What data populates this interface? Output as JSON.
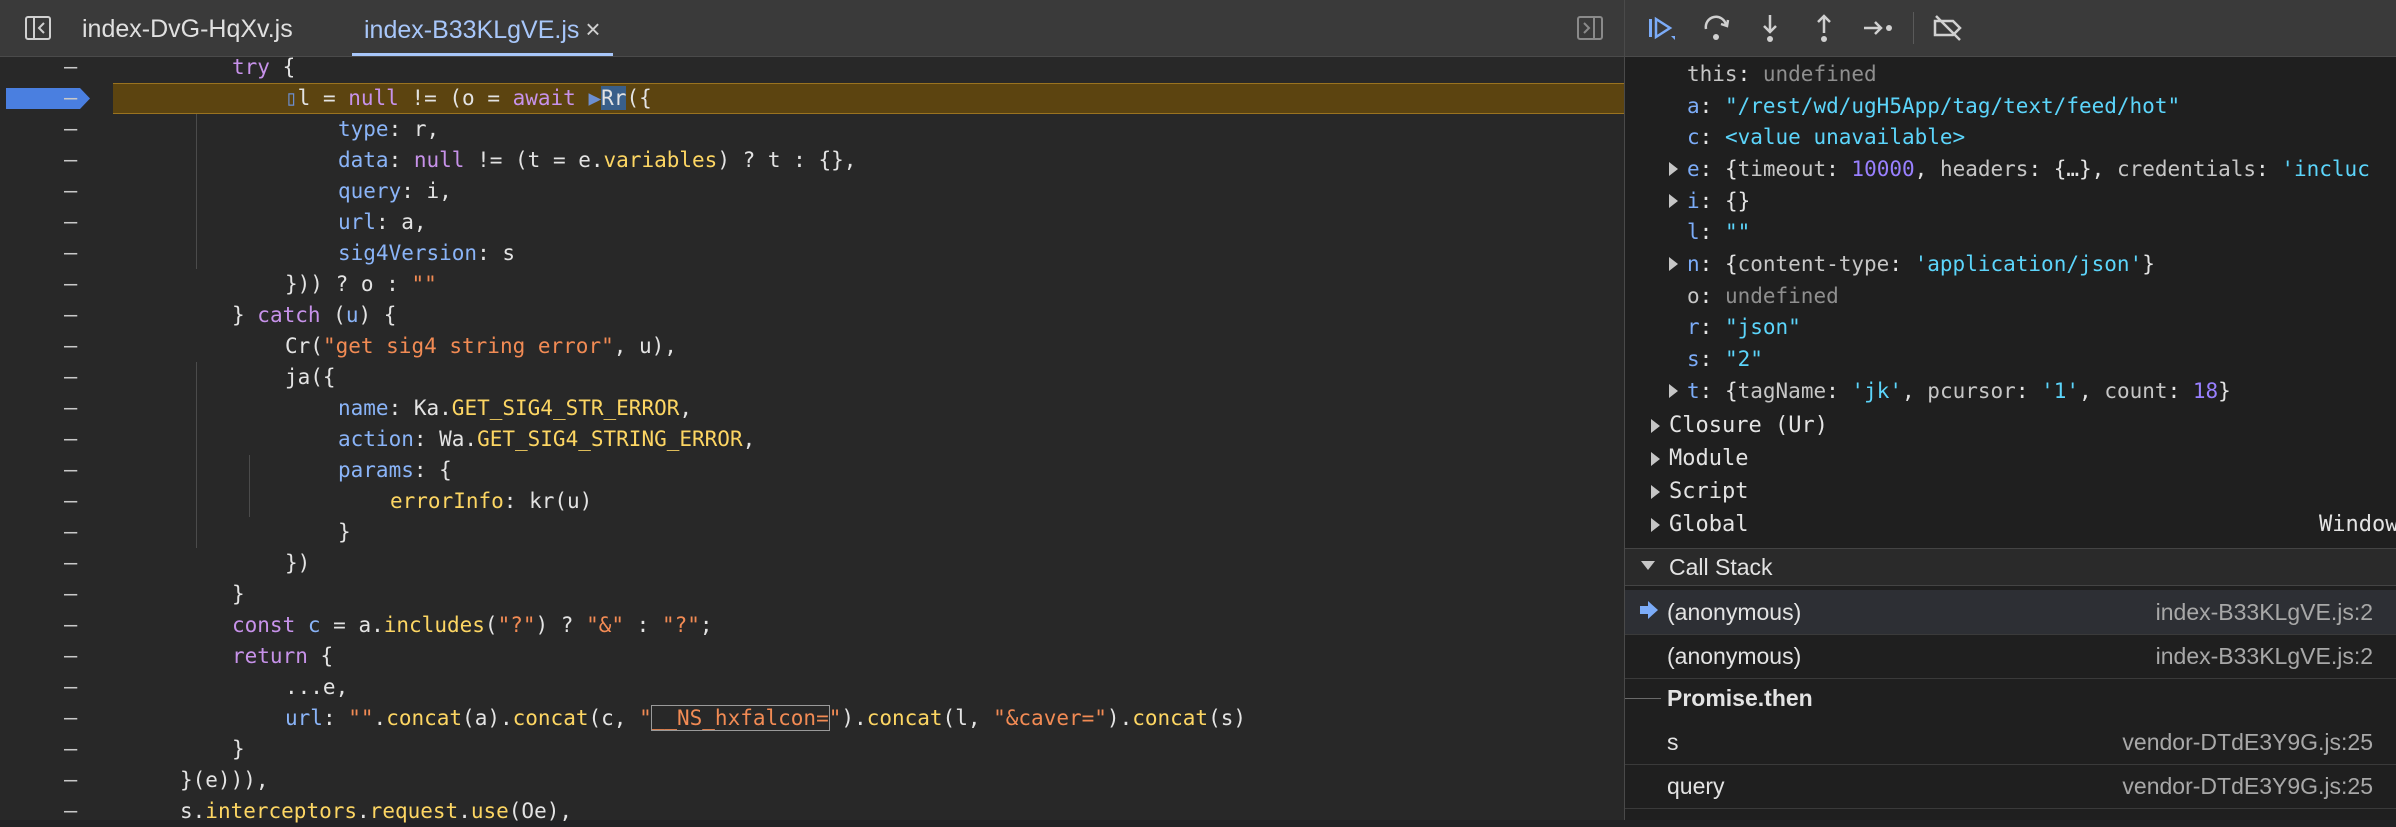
{
  "editor": {
    "tabs": [
      {
        "label": "index-DvG-HqXv.js"
      },
      {
        "label": "index-B33KLgVE.js",
        "close": "×"
      }
    ],
    "gutter_mark": "–",
    "code_lines": [
      {
        "seg": [
          [
            "k",
            "try"
          ],
          [
            "o",
            " {"
          ]
        ]
      },
      {
        "seg": [
          [
            "bp",
            "▯"
          ],
          [
            "o",
            "l = "
          ],
          [
            "k",
            "null"
          ],
          [
            "o",
            " != (o = "
          ],
          [
            "k",
            "await"
          ],
          [
            "o",
            " "
          ],
          [
            "bp",
            "▶"
          ],
          [
            "cur",
            "Rr"
          ],
          [
            "o",
            "({"
          ]
        ]
      },
      {
        "seg": [
          [
            "p",
            "type"
          ],
          [
            "o",
            ": r,"
          ]
        ]
      },
      {
        "seg": [
          [
            "p",
            "data"
          ],
          [
            "o",
            ": "
          ],
          [
            "k",
            "null"
          ],
          [
            "o",
            " != (t = e."
          ],
          [
            "f",
            "variables"
          ],
          [
            "o",
            ") ? t : {},"
          ]
        ]
      },
      {
        "seg": [
          [
            "p",
            "query"
          ],
          [
            "o",
            ": i,"
          ]
        ]
      },
      {
        "seg": [
          [
            "p",
            "url"
          ],
          [
            "o",
            ": a,"
          ]
        ]
      },
      {
        "seg": [
          [
            "p",
            "sig4Version"
          ],
          [
            "o",
            ": s"
          ]
        ]
      },
      {
        "seg": [
          [
            "o",
            "})"
          ],
          [
            "o",
            ") ? o : "
          ],
          [
            "s",
            "\"\""
          ]
        ]
      },
      {
        "seg": [
          [
            "o",
            "} "
          ],
          [
            "k",
            "catch"
          ],
          [
            "o",
            " ("
          ],
          [
            "p",
            "u"
          ],
          [
            "o",
            ") {"
          ]
        ]
      },
      {
        "seg": [
          [
            "o",
            "Cr("
          ],
          [
            "s",
            "\"get sig4 string error\""
          ],
          [
            "o",
            ", u),"
          ]
        ]
      },
      {
        "seg": [
          [
            "o",
            "ja({"
          ]
        ]
      },
      {
        "seg": [
          [
            "p",
            "name"
          ],
          [
            "o",
            ": Ka."
          ],
          [
            "f",
            "GET_SIG4_STR_ERROR"
          ],
          [
            "o",
            ","
          ]
        ]
      },
      {
        "seg": [
          [
            "p",
            "action"
          ],
          [
            "o",
            ": Wa."
          ],
          [
            "f",
            "GET_SIG4_STRING_ERROR"
          ],
          [
            "o",
            ","
          ]
        ]
      },
      {
        "seg": [
          [
            "p",
            "params"
          ],
          [
            "o",
            ": {"
          ]
        ]
      },
      {
        "seg": [
          [
            "f",
            "errorInfo"
          ],
          [
            "o",
            ": kr(u)"
          ]
        ]
      },
      {
        "seg": [
          [
            "o",
            "}"
          ]
        ]
      },
      {
        "seg": [
          [
            "o",
            "})"
          ]
        ]
      },
      {
        "seg": [
          [
            "o",
            "}"
          ]
        ]
      },
      {
        "seg": [
          [
            "k",
            "const"
          ],
          [
            "o",
            " "
          ],
          [
            "p",
            "c"
          ],
          [
            "o",
            " = a."
          ],
          [
            "f",
            "includes"
          ],
          [
            "o",
            "("
          ],
          [
            "s",
            "\"?\""
          ],
          [
            "o",
            ") ? "
          ],
          [
            "s",
            "\"&\""
          ],
          [
            "o",
            " : "
          ],
          [
            "s",
            "\"?\""
          ],
          [
            "o",
            ";"
          ]
        ]
      },
      {
        "seg": [
          [
            "k",
            "return"
          ],
          [
            "o",
            " {"
          ]
        ]
      },
      {
        "seg": [
          [
            "o",
            "...e,"
          ]
        ]
      },
      {
        "seg": [
          [
            "p",
            "url"
          ],
          [
            "o",
            ": "
          ],
          [
            "s",
            "\"\""
          ],
          [
            "o",
            "."
          ],
          [
            "f",
            "concat"
          ],
          [
            "o",
            "(a)."
          ],
          [
            "f",
            "concat"
          ],
          [
            "o",
            "(c, "
          ],
          [
            "s",
            "\""
          ],
          [
            "sbx",
            "__NS_hxfalcon="
          ],
          [
            "s",
            "\""
          ],
          [
            "o",
            ")."
          ],
          [
            "f",
            "concat"
          ],
          [
            "o",
            "(l, "
          ],
          [
            "s",
            "\"&caver=\""
          ],
          [
            "o",
            ")."
          ],
          [
            "f",
            "concat"
          ],
          [
            "o",
            "(s)"
          ]
        ]
      },
      {
        "seg": [
          [
            "o",
            "}"
          ]
        ]
      },
      {
        "seg": [
          [
            "o",
            "}(e))),"
          ]
        ]
      },
      {
        "seg": [
          [
            "o",
            "s."
          ],
          [
            "f",
            "interceptors"
          ],
          [
            "o",
            "."
          ],
          [
            "f",
            "request"
          ],
          [
            "o",
            "."
          ],
          [
            "f",
            "use"
          ],
          [
            "o",
            "(Oe),"
          ]
        ]
      }
    ]
  },
  "scope": {
    "rows": [
      {
        "key": "this",
        "sep": ": ",
        "val": "undefined",
        "cls": "v-undef",
        "expand": false,
        "hot": false
      },
      {
        "key": "a",
        "sep": ": ",
        "val": "\"/rest/wd/ugH5App/tag/text/feed/hot\"",
        "cls": "v-str",
        "expand": false,
        "hot": true
      },
      {
        "key": "c",
        "sep": ": ",
        "val": "<value unavailable>",
        "cls": "v-str",
        "expand": false,
        "hot": true
      },
      {
        "key": "e",
        "sep": ": ",
        "rich": [
          [
            "v-obj",
            "{"
          ],
          [
            "key",
            "timeout"
          ],
          [
            "v-obj",
            ": "
          ],
          [
            "v-num",
            "10000"
          ],
          [
            "v-obj",
            ", "
          ],
          [
            "key",
            "headers"
          ],
          [
            "v-obj",
            ": {…}, "
          ],
          [
            "key",
            "credentials"
          ],
          [
            "v-obj",
            ": "
          ],
          [
            "v-str",
            "'incluc"
          ]
        ],
        "expand": true,
        "hot": true
      },
      {
        "key": "i",
        "sep": ": ",
        "val": "{}",
        "cls": "v-obj",
        "expand": true,
        "hot": true
      },
      {
        "key": "l",
        "sep": ": ",
        "val": "\"\"",
        "cls": "v-str",
        "expand": false,
        "hot": true
      },
      {
        "key": "n",
        "sep": ": ",
        "rich": [
          [
            "v-obj",
            "{"
          ],
          [
            "key",
            "content-type"
          ],
          [
            "v-obj",
            ": "
          ],
          [
            "v-str",
            "'application/json'"
          ],
          [
            "v-obj",
            "}"
          ]
        ],
        "expand": true,
        "hot": true
      },
      {
        "key": "o",
        "sep": ": ",
        "val": "undefined",
        "cls": "v-undef",
        "expand": false,
        "hot": false
      },
      {
        "key": "r",
        "sep": ": ",
        "val": "\"json\"",
        "cls": "v-str",
        "expand": false,
        "hot": true
      },
      {
        "key": "s",
        "sep": ": ",
        "val": "\"2\"",
        "cls": "v-str",
        "expand": false,
        "hot": true
      },
      {
        "key": "t",
        "sep": ": ",
        "rich": [
          [
            "v-obj",
            "{"
          ],
          [
            "key",
            "tagName"
          ],
          [
            "v-obj",
            ": "
          ],
          [
            "v-str",
            "'jk'"
          ],
          [
            "v-obj",
            ", "
          ],
          [
            "key",
            "pcursor"
          ],
          [
            "v-obj",
            ": "
          ],
          [
            "v-str",
            "'1'"
          ],
          [
            "v-obj",
            ", "
          ],
          [
            "key",
            "count"
          ],
          [
            "v-obj",
            ": "
          ],
          [
            "v-num",
            "18"
          ],
          [
            "v-obj",
            "}"
          ]
        ],
        "expand": true,
        "hot": true
      }
    ],
    "groups": [
      {
        "label": "Closure (Ur)",
        "right": ""
      },
      {
        "label": "Module",
        "right": ""
      },
      {
        "label": "Script",
        "right": ""
      },
      {
        "label": "Global",
        "right": "Window"
      }
    ]
  },
  "call_stack": {
    "title": "Call Stack",
    "frames": [
      {
        "name": "(anonymous)",
        "file": "index-B33KLgVE.js:2",
        "selected": true
      },
      {
        "name": "(anonymous)",
        "file": "index-B33KLgVE.js:2",
        "selected": false
      }
    ],
    "async_label": "Promise.then",
    "async_frames": [
      {
        "name": "s",
        "file": "vendor-DTdE3Y9G.js:25"
      },
      {
        "name": "query",
        "file": "vendor-DTdE3Y9G.js:25"
      }
    ]
  },
  "colors": {
    "paused_line": "#5c4410",
    "accent": "#a8c7fa",
    "breakpoint": "#4a7fe0"
  }
}
